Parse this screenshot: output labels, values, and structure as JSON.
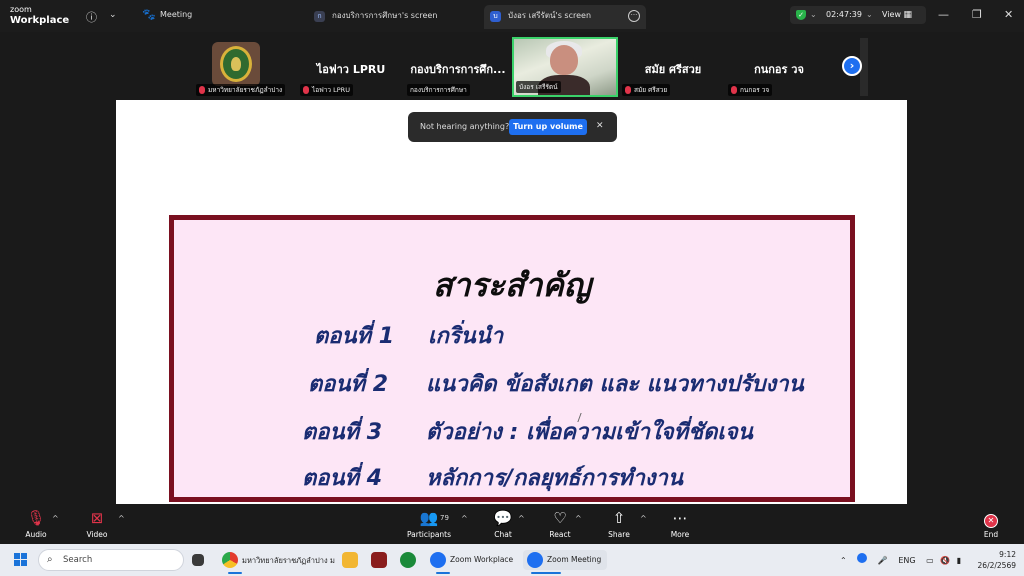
{
  "app": {
    "logo_line1": "zoom",
    "logo_line2": "Workplace",
    "meeting_label": "Meeting"
  },
  "tabs": [
    {
      "badge": "ก",
      "label": "กองบริการการศึกษา's screen"
    },
    {
      "badge": "บ",
      "label": "บังอร เสรีรัตน์'s screen"
    }
  ],
  "timer": {
    "time": "02:47:39",
    "view_label": "View"
  },
  "participants": [
    {
      "label": "มหาวิทยาลัยราชภัฏลำปาง"
    },
    {
      "big": "ไอฟาว LPRU",
      "label": "ไอฟาว LPRU"
    },
    {
      "big": "กองบริการการศึก...",
      "label": "กองบริการการศึกษา"
    },
    {
      "label": "บังอร เสรีรัตน์"
    },
    {
      "big": "สมัย ศรีสวย",
      "label": "สมัย ศรีสวย"
    },
    {
      "big": "กนกอร วจ",
      "label": "กนกอร วจ"
    }
  ],
  "toast": {
    "text": "Not hearing anything?",
    "button": "Turn up volume"
  },
  "slide": {
    "title": "สาระสำคัญ",
    "rows": [
      {
        "label": "ตอนที่ 1",
        "text": "เกริ่นนำ"
      },
      {
        "label": "ตอนที่ 2",
        "text": "แนวคิด ข้อสังเกต และ แนวทางปรับงาน"
      },
      {
        "label": "ตอนที่ 3",
        "text": "ตัวอย่าง :  เพื่อความเข้าใจที่ชัดเจน"
      },
      {
        "label": "ตอนที่ 4",
        "text": "หลักการ/กลยุทธ์การทำงาน"
      }
    ]
  },
  "toolbar": {
    "audio": "Audio",
    "video": "Video",
    "participants": "Participants",
    "participant_count": "79",
    "chat": "Chat",
    "react": "React",
    "share": "Share",
    "more": "More",
    "end": "End"
  },
  "taskbar": {
    "search_placeholder": "Search",
    "apps": [
      {
        "label": "มหาวิทยาลัยราชภัฏลำปาง ม"
      },
      {
        "label": "Zoom Workplace"
      },
      {
        "label": "Zoom Meeting"
      }
    ],
    "lang": "ENG",
    "time": "9:12",
    "date": "26/2/2569"
  },
  "colors": {
    "accent": "#1e6ff0",
    "slide_border": "#7a1020",
    "slide_bg": "#fde6f6",
    "slide_text": "#1a2c72",
    "active_speaker": "#3bd26a",
    "danger": "#e0344a"
  }
}
